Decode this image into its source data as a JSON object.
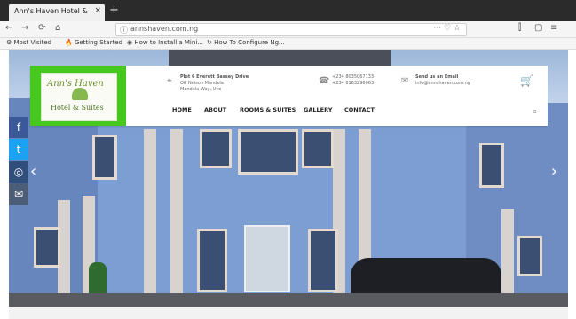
{
  "browser": {
    "tab_title": "Ann's Haven Hotel & Reso",
    "tab_close": "×",
    "new_tab": "+",
    "back": "←",
    "forward": "→",
    "reload": "⟳",
    "home": "⌂",
    "url": "annshaven.com.ng",
    "url_actions": "··· ♡ ☆",
    "library": "⫿",
    "sidebar": "▢",
    "menu": "≡",
    "bookmarks": [
      "⚙ Most Visited",
      "🔥 Getting Started",
      "◉ How to Install a Mini...",
      "↻ How To Configure Ng..."
    ]
  },
  "site": {
    "logo_title": "Ann's Haven",
    "logo_subtitle": "Hotel & Suites",
    "address_title": "Plot 6 Everett Bassey Drive",
    "address_line2": "Off Nelson Mandela",
    "address_line3": "Mandela Way, Uyo",
    "phone_line1": "+234 8035067133",
    "phone_line2": "+234 8163296063",
    "email_title": "Send us an Email",
    "email_value": "info@annshaven.com.ng",
    "menu": [
      "HOME",
      "ABOUT",
      "ROOMS & SUITES",
      "GALLERY",
      "CONTACT"
    ],
    "social": [
      "f",
      "t",
      "◎",
      "✉"
    ],
    "search_icon": "⌕",
    "cart_icon": "🛒",
    "slider_next": "›",
    "slider_prev": "‹"
  },
  "colors": {
    "green": "#46c81e",
    "menu_text": "#222222",
    "header_bg": "#ffffff",
    "facebook": "#3b5998",
    "twitter": "#1da1f2"
  }
}
